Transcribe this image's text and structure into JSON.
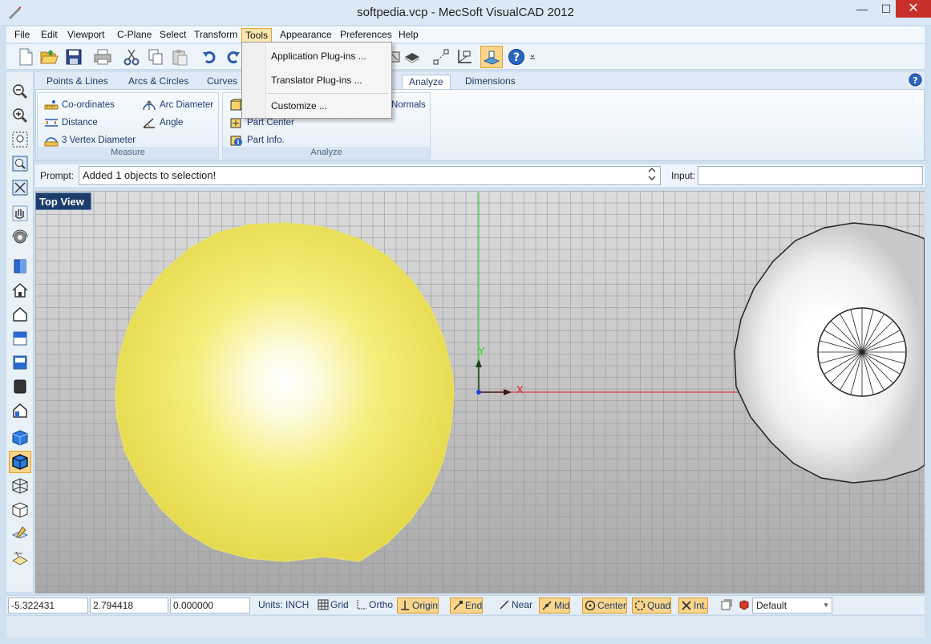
{
  "window": {
    "title": "softpedia.vcp - MecSoft VisualCAD 2012",
    "min_glyph": "—",
    "max_glyph": "☐",
    "close_glyph": "✕"
  },
  "menubar": {
    "items": [
      "File",
      "Edit",
      "Viewport",
      "C-Plane",
      "Select",
      "Transform",
      "Tools",
      "Appearance",
      "Preferences",
      "Help"
    ],
    "active": "Tools"
  },
  "tools_menu": {
    "items": [
      "Application Plug-ins ...",
      "Translator Plug-ins ...",
      "Customize ..."
    ]
  },
  "ribbon": {
    "tabs": [
      "Points & Lines",
      "Arcs & Circles",
      "Curves",
      "Analyze",
      "Dimensions"
    ],
    "active_tab": "Analyze",
    "measure_group": {
      "title": "Measure",
      "items": [
        "Co-ordinates",
        "Arc Diameter",
        "Distance",
        "Angle",
        "3 Vertex Diameter"
      ]
    },
    "analyze_group": {
      "title": "Analyze",
      "items": [
        "Part Center",
        "Part Info.",
        "Normals"
      ]
    }
  },
  "prompt": {
    "label": "Prompt:",
    "text": "Added 1 objects to selection!",
    "input_label": "Input:",
    "input_value": ""
  },
  "viewport": {
    "label": "Top View",
    "axis_x": "X",
    "axis_y": "Y"
  },
  "statusbar": {
    "x": "-5.322431",
    "y": "2.794418",
    "z": "0.000000",
    "units": "Units: INCH",
    "toggles": [
      {
        "label": "Grid",
        "on": false
      },
      {
        "label": "Ortho",
        "on": false
      },
      {
        "label": "Origin",
        "on": true
      },
      {
        "label": "End",
        "on": true
      },
      {
        "label": "Near",
        "on": false
      },
      {
        "label": "Mid",
        "on": true
      },
      {
        "label": "Center",
        "on": true
      },
      {
        "label": "Quad",
        "on": true
      },
      {
        "label": "Int.",
        "on": true
      }
    ],
    "layer": "Default"
  },
  "colors": {
    "accent_on": "#fbd58a",
    "view_label_bg": "#1c3c6c",
    "sphere": "#f2ec66"
  }
}
